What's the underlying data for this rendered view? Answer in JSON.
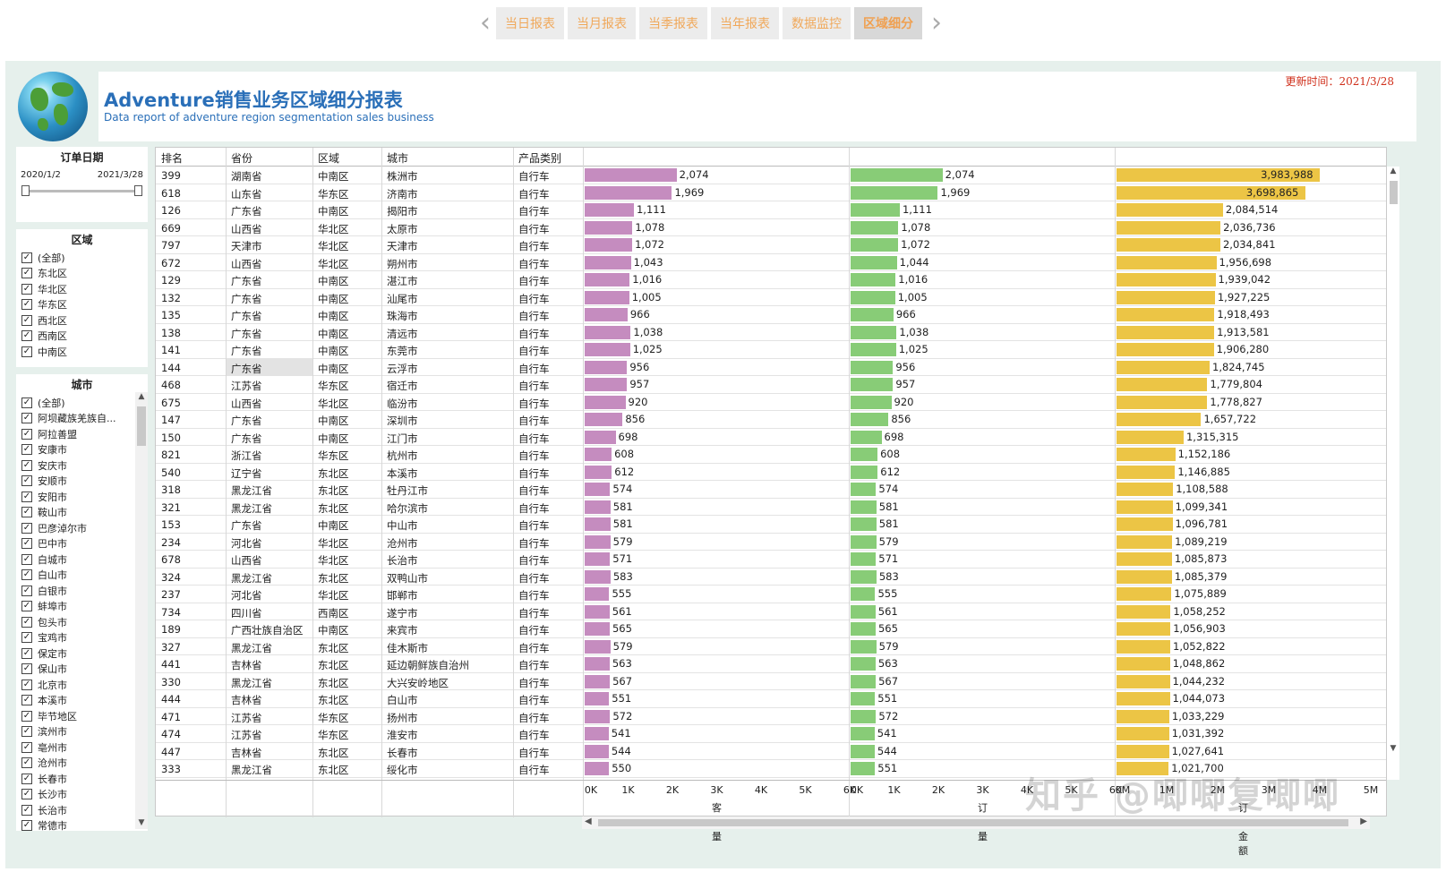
{
  "nav": {
    "tabs": [
      "当日报表",
      "当月报表",
      "当季报表",
      "当年报表",
      "数据监控",
      "区域细分"
    ],
    "active": 5,
    "prev": "‹",
    "next": "›"
  },
  "header": {
    "title": "Adventure销售业务区域细分报表",
    "subtitle": "Data report of adventure region segmentation sales business",
    "update_label": "更新时间：",
    "update_value": "2021/3/28"
  },
  "date_slicer": {
    "title": "订单日期",
    "start": "2020/1/2",
    "end": "2021/3/28"
  },
  "region_slicer": {
    "title": "区域",
    "items": [
      "(全部)",
      "东北区",
      "华北区",
      "华东区",
      "西北区",
      "西南区",
      "中南区"
    ]
  },
  "city_slicer": {
    "title": "城市",
    "items": [
      "(全部)",
      "阿坝藏族羌族自...",
      "阿拉善盟",
      "安康市",
      "安庆市",
      "安顺市",
      "安阳市",
      "鞍山市",
      "巴彦淖尔市",
      "巴中市",
      "白城市",
      "白山市",
      "白银市",
      "蚌埠市",
      "包头市",
      "宝鸡市",
      "保定市",
      "保山市",
      "北京市",
      "本溪市",
      "毕节地区",
      "滨州市",
      "亳州市",
      "沧州市",
      "长春市",
      "长沙市",
      "长治市",
      "常德市"
    ]
  },
  "table": {
    "columns": [
      "排名",
      "省份",
      "区域",
      "城市",
      "产品类别"
    ],
    "measures": [
      {
        "name": "客户量",
        "color": "#c58cbf",
        "max": 6000,
        "ticks": [
          "0K",
          "1K",
          "2K",
          "3K",
          "4K",
          "5K",
          "6K"
        ]
      },
      {
        "name": "订单量",
        "color": "#88cc77",
        "max": 6000,
        "ticks": [
          "0K",
          "1K",
          "2K",
          "3K",
          "4K",
          "5K",
          "6K"
        ]
      },
      {
        "name": "订单金额",
        "color": "#ecc545",
        "max": 5000000,
        "ticks": [
          "0M",
          "1M",
          "2M",
          "3M",
          "4M",
          "5M"
        ]
      }
    ],
    "rows": [
      [
        "399",
        "湖南省",
        "中南区",
        "株洲市",
        "自行车",
        "2,074",
        "2,074",
        "3,983,988"
      ],
      [
        "618",
        "山东省",
        "华东区",
        "济南市",
        "自行车",
        "1,969",
        "1,969",
        "3,698,865"
      ],
      [
        "126",
        "广东省",
        "中南区",
        "揭阳市",
        "自行车",
        "1,111",
        "1,111",
        "2,084,514"
      ],
      [
        "669",
        "山西省",
        "华北区",
        "太原市",
        "自行车",
        "1,078",
        "1,078",
        "2,036,736"
      ],
      [
        "797",
        "天津市",
        "华北区",
        "天津市",
        "自行车",
        "1,072",
        "1,072",
        "2,034,841"
      ],
      [
        "672",
        "山西省",
        "华北区",
        "朔州市",
        "自行车",
        "1,043",
        "1,044",
        "1,956,698"
      ],
      [
        "129",
        "广东省",
        "中南区",
        "湛江市",
        "自行车",
        "1,016",
        "1,016",
        "1,939,042"
      ],
      [
        "132",
        "广东省",
        "中南区",
        "汕尾市",
        "自行车",
        "1,005",
        "1,005",
        "1,927,225"
      ],
      [
        "135",
        "广东省",
        "中南区",
        "珠海市",
        "自行车",
        "966",
        "966",
        "1,918,493"
      ],
      [
        "138",
        "广东省",
        "中南区",
        "清远市",
        "自行车",
        "1,038",
        "1,038",
        "1,913,581"
      ],
      [
        "141",
        "广东省",
        "中南区",
        "东莞市",
        "自行车",
        "1,025",
        "1,025",
        "1,906,280"
      ],
      [
        "144",
        "广东省",
        "中南区",
        "云浮市",
        "自行车",
        "956",
        "956",
        "1,824,745"
      ],
      [
        "468",
        "江苏省",
        "华东区",
        "宿迁市",
        "自行车",
        "957",
        "957",
        "1,779,804"
      ],
      [
        "675",
        "山西省",
        "华北区",
        "临汾市",
        "自行车",
        "920",
        "920",
        "1,778,827"
      ],
      [
        "147",
        "广东省",
        "中南区",
        "深圳市",
        "自行车",
        "856",
        "856",
        "1,657,722"
      ],
      [
        "150",
        "广东省",
        "中南区",
        "江门市",
        "自行车",
        "698",
        "698",
        "1,315,315"
      ],
      [
        "821",
        "浙江省",
        "华东区",
        "杭州市",
        "自行车",
        "608",
        "608",
        "1,152,186"
      ],
      [
        "540",
        "辽宁省",
        "东北区",
        "本溪市",
        "自行车",
        "612",
        "612",
        "1,146,885"
      ],
      [
        "318",
        "黑龙江省",
        "东北区",
        "牡丹江市",
        "自行车",
        "574",
        "574",
        "1,108,588"
      ],
      [
        "321",
        "黑龙江省",
        "东北区",
        "哈尔滨市",
        "自行车",
        "581",
        "581",
        "1,099,341"
      ],
      [
        "153",
        "广东省",
        "中南区",
        "中山市",
        "自行车",
        "581",
        "581",
        "1,096,781"
      ],
      [
        "234",
        "河北省",
        "华北区",
        "沧州市",
        "自行车",
        "579",
        "579",
        "1,089,219"
      ],
      [
        "678",
        "山西省",
        "华北区",
        "长治市",
        "自行车",
        "571",
        "571",
        "1,085,873"
      ],
      [
        "324",
        "黑龙江省",
        "东北区",
        "双鸭山市",
        "自行车",
        "583",
        "583",
        "1,085,379"
      ],
      [
        "237",
        "河北省",
        "华北区",
        "邯郸市",
        "自行车",
        "555",
        "555",
        "1,075,889"
      ],
      [
        "734",
        "四川省",
        "西南区",
        "遂宁市",
        "自行车",
        "561",
        "561",
        "1,058,252"
      ],
      [
        "189",
        "广西壮族自治区",
        "中南区",
        "来宾市",
        "自行车",
        "565",
        "565",
        "1,056,903"
      ],
      [
        "327",
        "黑龙江省",
        "东北区",
        "佳木斯市",
        "自行车",
        "579",
        "579",
        "1,052,822"
      ],
      [
        "441",
        "吉林省",
        "东北区",
        "延边朝鲜族自治州",
        "自行车",
        "563",
        "563",
        "1,048,862"
      ],
      [
        "330",
        "黑龙江省",
        "东北区",
        "大兴安岭地区",
        "自行车",
        "567",
        "567",
        "1,044,232"
      ],
      [
        "444",
        "吉林省",
        "东北区",
        "白山市",
        "自行车",
        "551",
        "551",
        "1,044,073"
      ],
      [
        "471",
        "江苏省",
        "华东区",
        "扬州市",
        "自行车",
        "572",
        "572",
        "1,033,229"
      ],
      [
        "474",
        "江苏省",
        "华东区",
        "淮安市",
        "自行车",
        "541",
        "541",
        "1,031,392"
      ],
      [
        "447",
        "吉林省",
        "东北区",
        "长春市",
        "自行车",
        "544",
        "544",
        "1,027,641"
      ],
      [
        "333",
        "黑龙江省",
        "东北区",
        "绥化市",
        "自行车",
        "550",
        "551",
        "1,021,700"
      ]
    ]
  },
  "watermark": "知乎 @唧唧复唧唧"
}
